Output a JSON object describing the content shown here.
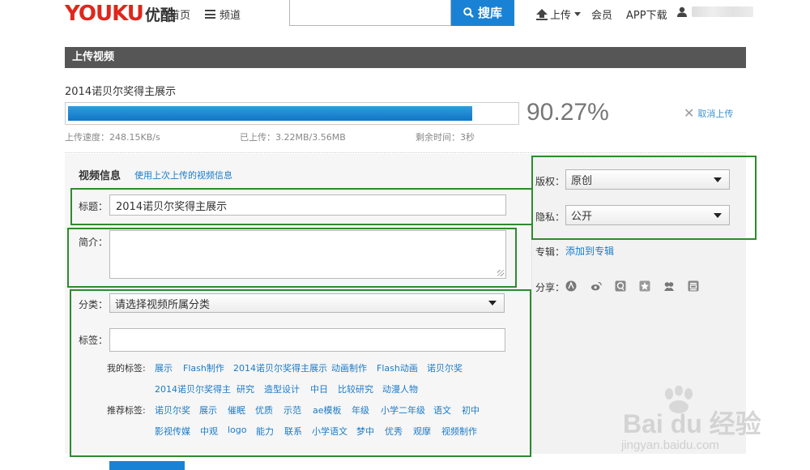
{
  "header": {
    "logo_en": "YOUKU",
    "logo_cn": "优酷",
    "nav_home": "首页",
    "nav_channel": "频道",
    "search_placeholder": "",
    "search_button": "搜库",
    "upload": "上传",
    "member": "会员",
    "app_download": "APP下载"
  },
  "section_title": "上传视频",
  "upload": {
    "video_name": "2014诺贝尔奖得主展示",
    "progress_percent": 90.27,
    "percent_text": "90.27%",
    "cancel": "取消上传",
    "speed": "上传速度：248.15KB/s",
    "uploaded": "已上传：3.22MB/3.56MB",
    "remaining": "剩余时间：3秒"
  },
  "form": {
    "info_title": "视频信息",
    "use_last": "使用上次上传的视频信息",
    "title_label": "标题：",
    "title_value": "2014诺贝尔奖得主展示",
    "desc_label": "简介：",
    "category_label": "分类：",
    "category_value": "请选择视频所属分类",
    "tags_label": "标签：",
    "tags_value": "",
    "my_tags_label": "我的标签:",
    "my_tags": [
      "展示",
      "Flash制作",
      "2014诺贝尔奖得主展示",
      "动画制作",
      "Flash动画",
      "诺贝尔奖",
      "2014诺贝尔奖得主",
      "研究",
      "造型设计",
      "中日",
      "比较研究",
      "动漫人物"
    ],
    "recommended_label": "推荐标签:",
    "recommended_tags": [
      "诺贝尔奖",
      "展示",
      "催眠",
      "优质",
      "示范",
      "ae模板",
      "年级",
      "小学二年级",
      "语文",
      "初中",
      "影视传媒",
      "中观",
      "logo",
      "能力",
      "联系",
      "小学语文",
      "梦中",
      "优秀",
      "观摩",
      "视频制作"
    ]
  },
  "side": {
    "copyright_label": "版权：",
    "copyright_value": "原创",
    "privacy_label": "隐私：",
    "privacy_value": "公开",
    "album_label": "专辑：",
    "album_link": "添加到专辑",
    "share_label": "分享："
  },
  "watermark": {
    "text": "Bai du 经验",
    "sub": "jingyan.baidu.com"
  },
  "colors": {
    "brand_red": "#e0261c",
    "accent_blue": "#1a82d4",
    "link_blue": "#1a7bc9",
    "highlight_green": "#2f8a2f"
  }
}
